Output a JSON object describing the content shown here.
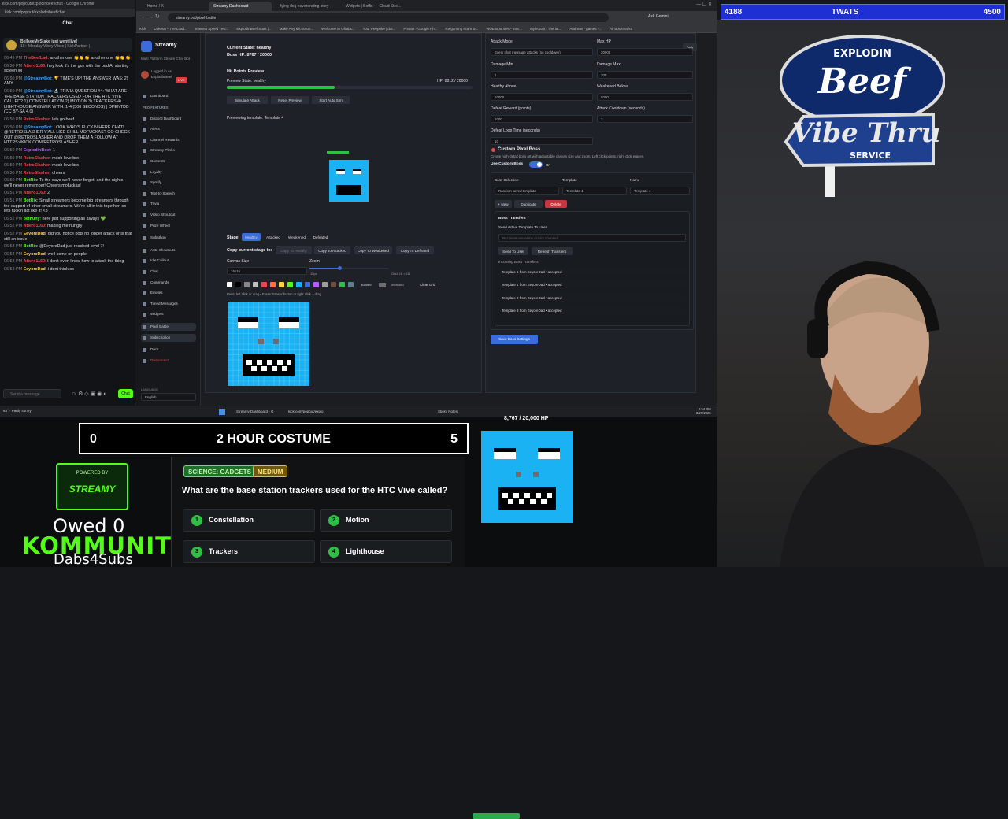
{
  "chat_window": {
    "title": "kick.com/popout/explodinbeef/chat - Google Chrome",
    "url": "kick.com/popout/explodinbeef/chat",
    "header": "Chat",
    "banner_title": "BellseeMyStake just went live!",
    "banner_sub": "18+ Monday Vibey Vibes | KickPartner | ",
    "input_placeholder": "Send a message",
    "send_label": "Chat",
    "messages": [
      {
        "time": "06:49 PM",
        "user": "TheBeefLad",
        "color": "#e5484d",
        "text": "another one 👏👏👏 another one 👏👏👏"
      },
      {
        "time": "06:50 PM",
        "user": "Attero1160",
        "color": "#e5484d",
        "text": "hey look it's the guy with the bad AI starting screen lol"
      },
      {
        "time": "06:50 PM",
        "user": "@StreamyBot",
        "color": "#3aa0ff",
        "text": "🏆 TIME'S UP! THE ANSWER WAS: 2) AMY"
      },
      {
        "time": "06:50 PM",
        "user": "@StreamyBot",
        "color": "#3aa0ff",
        "text": "🔬 TRIVIA QUESTION #4: WHAT ARE THE BASE STATION TRACKERS USED FOR THE HTC VIVE CALLED? 1) CONSTELLATION 2) MOTION 3) TRACKERS 4) LIGHTHOUSE ANSWER WITH: 1-4 (300 SECONDS) | OPENTDB (CC BY-SA 4.0)"
      },
      {
        "time": "06:50 PM",
        "user": "RetroSlasher",
        "color": "#e5484d",
        "text": "lets go beef"
      },
      {
        "time": "06:50 PM",
        "user": "@StreamyBot",
        "color": "#3aa0ff",
        "text": "LOOK WHO'S FUCKIN HERE CHAT! @RETROSLASHER Y'ALL LIKE CHILL MOFUCKAS? GO CHECK OUT @RETROSLASHER AND DROP THEM A FOLLOW AT HTTPS://KICK.COM/RETROSLASHER"
      },
      {
        "time": "06:50 PM",
        "user": "ExplodinBeef",
        "color": "#b45cff",
        "text": "1"
      },
      {
        "time": "06:50 PM",
        "user": "RetroSlasher",
        "color": "#e5484d",
        "text": "much love bro"
      },
      {
        "time": "06:50 PM",
        "user": "RetroSlasher",
        "color": "#e5484d",
        "text": "much love bro"
      },
      {
        "time": "06:50 PM",
        "user": "RetroSlasher",
        "color": "#e5484d",
        "text": "cheers"
      },
      {
        "time": "06:50 PM",
        "user": "BotRix",
        "color": "#53fc18",
        "text": "To the days we'll never forget, and the nights we'll never remember! Cheers mofuckas!"
      },
      {
        "time": "06:51 PM",
        "user": "Attero1160",
        "color": "#e5484d",
        "text": "2"
      },
      {
        "time": "06:51 PM",
        "user": "BotRix",
        "color": "#53fc18",
        "text": "Small streamers become big streamers through the support of other small streamers. We're all in this together, so lets fuckin act like it! <3"
      },
      {
        "time": "06:52 PM",
        "user": "bethuny",
        "color": "#53fc18",
        "text": "here just supporting as always 💚"
      },
      {
        "time": "06:52 PM",
        "user": "Attero1160",
        "color": "#e5484d",
        "text": "making me hungry"
      },
      {
        "time": "06:52 PM",
        "user": "EeyoreDad",
        "color": "#ffd24a",
        "text": "did you notice bots no longer attack or is that still an issue"
      },
      {
        "time": "06:53 PM",
        "user": "BotRix",
        "color": "#53fc18",
        "text": "@EeyoreDad just reached level 7!"
      },
      {
        "time": "06:53 PM",
        "user": "EeyoreDad",
        "color": "#ffd24a",
        "text": "well come on people"
      },
      {
        "time": "06:53 PM",
        "user": "Attero1160",
        "color": "#e5484d",
        "text": "I don't even know how to attack the thing"
      },
      {
        "time": "06:53 PM",
        "user": "EeyoreDad",
        "color": "#ffd24a",
        "text": "i dont think so"
      }
    ]
  },
  "browser": {
    "tabs": [
      "Home / X",
      "Streamy Dashboard",
      "flying dog neverending story",
      "Widgets | Botfix — Cloud Stre..."
    ],
    "url": "streamy.bot/pixel-battle",
    "bookmarks": [
      "Kick",
      "Dokeun - The Load...",
      "Internet Speed Test...",
      "ExplodinBeef Stats |...",
      "Make Any Mic Soun...",
      "Welcome to Olllabs...",
      "Your Peepoke | dot...",
      "Photos - Google Ph...",
      "Re gaming scam w...",
      "WOE Bounties - mec...",
      "Mylectorit | The lat...",
      "Andreas - games -...",
      "All Bookmarks"
    ],
    "ask_label": "Ask Gemini"
  },
  "app": {
    "brand": "Streamy",
    "brand_sub": "Multi Platform Stream Chat Bot",
    "logged_in": "Logged in as",
    "username": "ExplodinBeef",
    "live": "LIVE",
    "nav": [
      {
        "label": "Dashboard",
        "type": "item"
      },
      {
        "label": "PRO FEATURES",
        "type": "hdr"
      },
      {
        "label": "Discord Dashboard",
        "type": "item"
      },
      {
        "label": "Alerts",
        "type": "item"
      },
      {
        "label": "Channel Rewards",
        "type": "item"
      },
      {
        "label": "Streamy Plinko",
        "type": "item"
      },
      {
        "label": "Contests",
        "type": "item"
      },
      {
        "label": "Loyalty",
        "type": "item"
      },
      {
        "label": "Spotify",
        "type": "item"
      },
      {
        "label": "Text-to-Speech",
        "type": "item"
      },
      {
        "label": "Trivia",
        "type": "item"
      },
      {
        "label": "Video Shoutout",
        "type": "item"
      },
      {
        "label": "Prize Wheel",
        "type": "item"
      },
      {
        "label": "Subathon",
        "type": "item"
      },
      {
        "label": "Auto Shoutouts",
        "type": "item"
      },
      {
        "label": "Idle Callout",
        "type": "item"
      },
      {
        "label": "Chat",
        "type": "item"
      },
      {
        "label": "Commands",
        "type": "item"
      },
      {
        "label": "Emotes",
        "type": "item"
      },
      {
        "label": "Timed Messages",
        "type": "item"
      },
      {
        "label": "Widgets",
        "type": "item"
      },
      {
        "label": "Pixel Battle",
        "type": "sel"
      },
      {
        "label": "Subscription",
        "type": "sel"
      },
      {
        "label": "Docs",
        "type": "item"
      },
      {
        "label": "Disconnect",
        "type": "red"
      }
    ],
    "language_label": "LANGUAGE",
    "language_value": "English"
  },
  "left_panel": {
    "current_state": "Current State: healthy",
    "boss_hp": "Boss HP: 8767 / 20000",
    "preview_title": "Hit Points Preview",
    "preview_state": "Preview State: healthy",
    "preview_hp": "HP: 8812 / 20000",
    "preview_progress": 0.44,
    "simulate": "Simulate Attack",
    "reset": "Reset Preview",
    "start_auto": "Start Auto Sim",
    "previewing": "Previewing template: Template 4",
    "stage_label": "Stage",
    "stages": [
      "Healthy",
      "Attacked",
      "Weakened",
      "Defeated"
    ],
    "copy_label": "Copy current stage to:",
    "copy_buttons": [
      "Copy To Healthy",
      "Copy To Attacked",
      "Copy To Weakened",
      "Copy To Defeated"
    ],
    "canvas_size_label": "Canvas Size",
    "canvas_size_value": "16x16",
    "zoom_label": "Zoom",
    "zoom_value": "18px",
    "grid_value": "Grid: 16 × 16",
    "eraser": "Eraser",
    "hex_value": "#6d6d6d",
    "clear_grid": "Clear Grid",
    "paint_hint": "Paint: left click or drag • Erase: Eraser button or right click + drag",
    "swatches": [
      "#ffffff",
      "#000000",
      "#888888",
      "#bfbfbf",
      "#e5484d",
      "#ff7043",
      "#ffd24a",
      "#53fc18",
      "#1ab2f2",
      "#3b6cd9",
      "#b45cff",
      "#9e9e9e",
      "#6d4c41",
      "#2fbf47",
      "#607d8b"
    ]
  },
  "right_panel": {
    "dark_label": "Dark",
    "attack_mode_label": "Attack Mode",
    "attack_mode_value": "Every chat message attacks (no cooldown)",
    "max_hp_label": "Max HP",
    "max_hp_value": "20000",
    "dmg_min_label": "Damage Min",
    "dmg_min_value": "1",
    "dmg_max_label": "Damage Max",
    "dmg_max_value": "200",
    "healthy_label": "Healthy Above",
    "healthy_value": "10000",
    "weakened_label": "Weakened Below",
    "weakened_value": "5000",
    "reward_label": "Defeat Reward (points)",
    "reward_value": "1000",
    "cooldown_label": "Attack Cooldown (seconds)",
    "cooldown_value": "3",
    "loop_label": "Defeat Loop Time (seconds)",
    "loop_value": "10",
    "custom_title": "Custom Pixel Boss",
    "custom_desc": "Create high-detail boss art with adjustable canvas size and zoom. Left click paints, right click erases.",
    "use_custom": "Use Custom Boss",
    "on_label": "On",
    "boss_sel_label": "Boss Selection",
    "boss_sel_value": "Random saved template",
    "template_label": "Template",
    "template_value": "Template 4",
    "name_label": "Name",
    "name_value": "Template 4",
    "new_btn": "+ New",
    "dup_btn": "Duplicate",
    "del_btn": "Delete",
    "transfers_title": "Boss Transfers",
    "send_active": "Send Active Template To User",
    "recipient_ph": "Recipient username or kick channel",
    "send_user": "Send To User",
    "refresh": "Refresh Transfers",
    "incoming_label": "Incoming Boss Transfers",
    "incoming": [
      "Template 5 from EeyoreDad • accepted",
      "Template 4 from EeyoreDad • accepted",
      "Template 2 from EeyoreDad • accepted",
      "Template 3 from EeyoreDad • accepted"
    ],
    "save": "Save Boss Settings"
  },
  "taskbar": {
    "search": "Streamy Dashboard - G",
    "kick": "kick.com/popout/explo",
    "sticky": "Sticky Notes",
    "time": "6:54 PM",
    "date": "3/26/2026",
    "weather": "63°F Partly sunny"
  },
  "overlay": {
    "score_left": "4188",
    "score_mid": "TWATS",
    "score_right": "4500",
    "costume_left": "0",
    "costume_title": "2 HOUR COSTUME",
    "costume_right": "5",
    "hp_label": "8,767 / 20,000 HP",
    "hp_progress": 0.44,
    "category": "SCIENCE: GADGETS",
    "difficulty": "MEDIUM",
    "question": "What are the base station trackers used for the HTC Vive called?",
    "answers": [
      {
        "n": "1",
        "label": "Constellation"
      },
      {
        "n": "2",
        "label": "Motion"
      },
      {
        "n": "3",
        "label": "Trackers"
      },
      {
        "n": "4",
        "label": "Lighthouse"
      }
    ],
    "owed": "Owed 0",
    "kommunity": "KOMMUNITY",
    "dabs": "Dabs4Subs",
    "powered_by": "POWERED BY",
    "streamy": "STREAMY",
    "logo_line1": "EXPLODIN",
    "logo_line2": "Beef",
    "logo_line3": "Vibe Thru",
    "logo_line4": "SERVICE"
  }
}
